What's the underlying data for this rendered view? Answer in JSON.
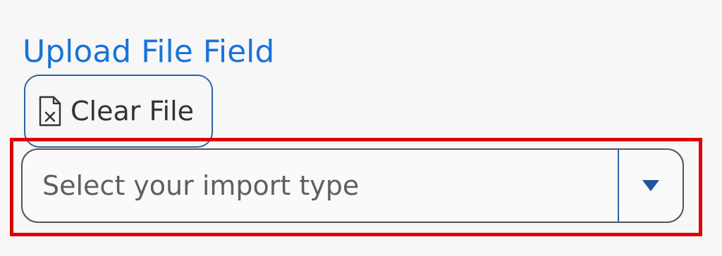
{
  "field": {
    "title": "Upload File Field"
  },
  "clear_button": {
    "label": "Clear File",
    "icon": "file-x-icon"
  },
  "import_select": {
    "placeholder": "Select your import type",
    "icon": "caret-down-icon"
  },
  "colors": {
    "title": "#1a73d9",
    "accent_border": "#2a63a8",
    "highlight": "#e00000",
    "text": "#333333",
    "placeholder": "#5f5f5f"
  }
}
